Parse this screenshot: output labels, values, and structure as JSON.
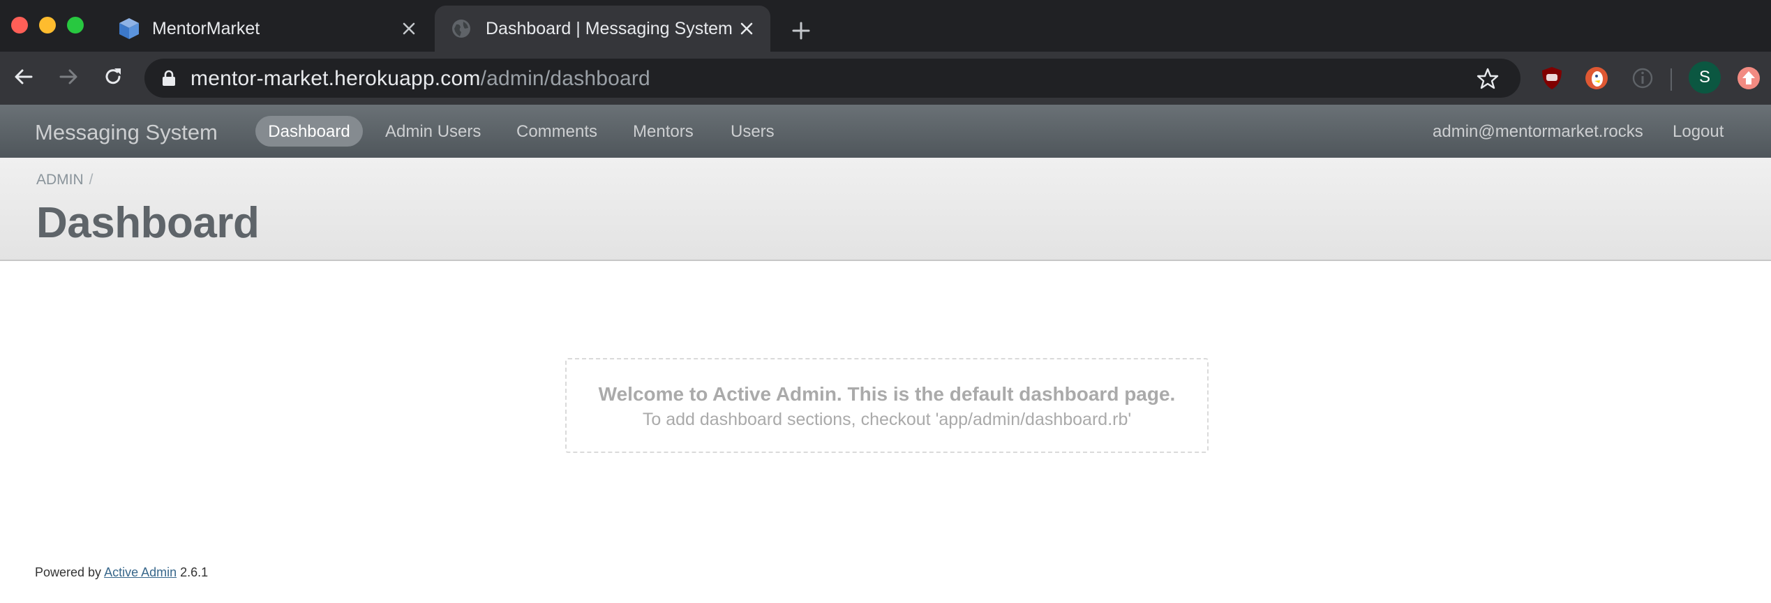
{
  "browser": {
    "tabs": [
      {
        "title": "MentorMarket",
        "favicon": "cube-icon",
        "active": false
      },
      {
        "title": "Dashboard | Messaging System",
        "favicon": "globe-icon",
        "active": true
      }
    ],
    "url_host": "mentor-market.herokuapp.com",
    "url_path": "/admin/dashboard",
    "profile_initial": "S"
  },
  "header": {
    "site_title": "Messaging System",
    "menu": [
      {
        "label": "Dashboard",
        "active": true
      },
      {
        "label": "Admin Users"
      },
      {
        "label": "Comments"
      },
      {
        "label": "Mentors"
      },
      {
        "label": "Users"
      }
    ],
    "utility": {
      "email": "admin@mentormarket.rocks",
      "logout": "Logout"
    }
  },
  "title_bar": {
    "breadcrumb": "ADMIN",
    "breadcrumb_separator": "/",
    "page_title": "Dashboard"
  },
  "main": {
    "blank_slate_title": "Welcome to Active Admin. This is the default dashboard page.",
    "blank_slate_sub": "To add dashboard sections, checkout 'app/admin/dashboard.rb'"
  },
  "footer": {
    "prefix": "Powered by",
    "link": "Active Admin",
    "version": "2.6.1"
  },
  "colors": {
    "header_bg": "#5e6469",
    "active_menu_bg": "#858b90",
    "title_text": "#5e6469",
    "link": "#38678b"
  }
}
